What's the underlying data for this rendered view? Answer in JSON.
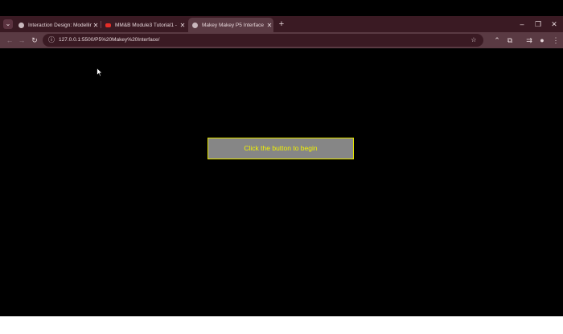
{
  "browser": {
    "tabs": [
      {
        "title": "Interaction Design: Modelling",
        "active": false,
        "favicon": "globe-icon"
      },
      {
        "title": "MM&B Module3 Tutorial1 - You",
        "active": false,
        "favicon": "youtube-icon"
      },
      {
        "title": "Makey Makey P5 Interface",
        "active": true,
        "favicon": "globe-icon"
      }
    ],
    "url": "127.0.0.1:5500/P5%20Makey%20Interface/",
    "colors": {
      "frame": "#3a1a23",
      "toolbar": "#5a3a43",
      "page_background": "#000000"
    }
  },
  "page": {
    "button_label": "Click the button to begin",
    "button_colors": {
      "fill": "#868686",
      "border": "#e8e800",
      "text": "#f2f200"
    }
  }
}
